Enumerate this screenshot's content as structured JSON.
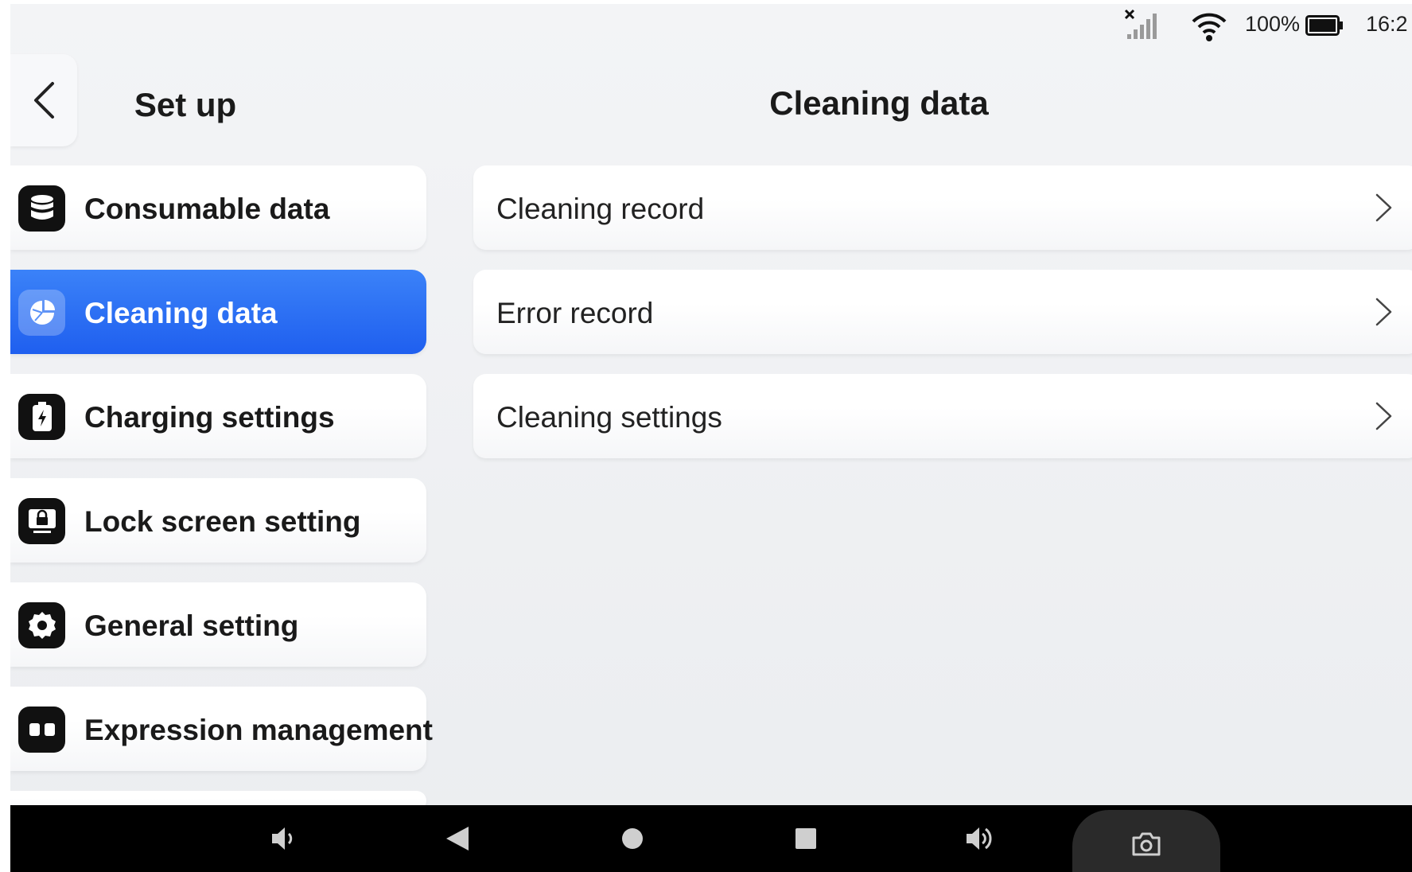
{
  "status_bar": {
    "battery_percent": "100%",
    "time": "16:2",
    "icons": [
      "no-signal-icon",
      "wifi-icon",
      "battery-icon"
    ]
  },
  "header": {
    "back_icon": "chevron-left-icon",
    "left_title": "Set up",
    "right_title": "Cleaning data"
  },
  "sidebar": {
    "items": [
      {
        "label": "Consumable data",
        "icon": "database-icon",
        "active": false
      },
      {
        "label": "Cleaning data",
        "icon": "pie-chart-icon",
        "active": true
      },
      {
        "label": "Charging settings",
        "icon": "battery-charging-icon",
        "active": false
      },
      {
        "label": "Lock screen setting",
        "icon": "lock-screen-icon",
        "active": false
      },
      {
        "label": "General setting",
        "icon": "gear-icon",
        "active": false
      },
      {
        "label": "Expression management",
        "icon": "expression-icon",
        "active": false
      }
    ]
  },
  "main": {
    "rows": [
      {
        "label": "Cleaning record",
        "icon": "chevron-right-icon"
      },
      {
        "label": "Error record",
        "icon": "chevron-right-icon"
      },
      {
        "label": "Cleaning settings",
        "icon": "chevron-right-icon"
      }
    ]
  },
  "nav_bar": {
    "buttons": [
      "volume-down-icon",
      "back-triangle-icon",
      "home-circle-icon",
      "recents-square-icon",
      "volume-up-icon",
      "camera-icon"
    ]
  },
  "colors": {
    "accent": "#2a6cf5",
    "background": "#eef0f3",
    "card": "#ffffff",
    "nav_bar": "#000000"
  }
}
